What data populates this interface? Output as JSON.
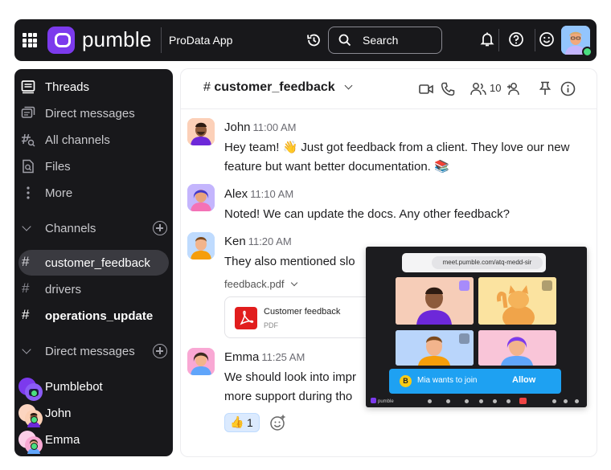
{
  "topbar": {
    "brand": "pumble",
    "workspace": "ProData App",
    "search_label": "Search"
  },
  "sidebar": {
    "nav": [
      {
        "label": "Threads",
        "icon": "threads-icon"
      },
      {
        "label": "Direct messages",
        "icon": "direct-messages-icon"
      },
      {
        "label": "All channels",
        "icon": "all-channels-icon"
      },
      {
        "label": "Files",
        "icon": "files-icon"
      },
      {
        "label": "More",
        "icon": "more-icon"
      }
    ],
    "channels_header": "Channels",
    "channels": [
      {
        "label": "customer_feedback",
        "active": true
      },
      {
        "label": "drivers",
        "active": false
      },
      {
        "label": "operations_update",
        "active": false,
        "unread": true
      }
    ],
    "dm_header": "Direct messages",
    "dms": [
      {
        "label": "Pumblebot"
      },
      {
        "label": "John"
      },
      {
        "label": "Emma"
      }
    ]
  },
  "channel": {
    "name": "customer_feedback",
    "member_count": "10"
  },
  "messages": [
    {
      "author": "John",
      "time": "11:00 AM",
      "text": "Hey team! 👋 Just got feedback from a client. They love our new feature but want better documentation. 📚"
    },
    {
      "author": "Alex",
      "time": "11:10 AM",
      "text": "Noted! We can update the docs. Any other feedback?"
    },
    {
      "author": "Ken",
      "time": "11:20 AM",
      "text": "They also mentioned slo"
    },
    {
      "author": "Emma",
      "time": "11:25 AM",
      "text": "We should look into impr more support during tho"
    }
  ],
  "attachment": {
    "label": "feedback.pdf",
    "title": "Customer feedback",
    "type": "PDF"
  },
  "reaction": {
    "emoji": "👍",
    "count": "1"
  },
  "meeting": {
    "url": "meet.pumble.com/atq-medd-sir",
    "join_initial": "B",
    "join_text": "Mia wants to join",
    "allow_label": "Allow",
    "logo_text": "pumble"
  },
  "colors": {
    "brand": "#7c3aed",
    "topbar_bg": "#18181b",
    "sidebar_bg": "#18181b",
    "active_item": "#3a3a40",
    "online": "#4ade80",
    "join_bar": "#1ea1f2",
    "pdf_red": "#e11d1d"
  }
}
